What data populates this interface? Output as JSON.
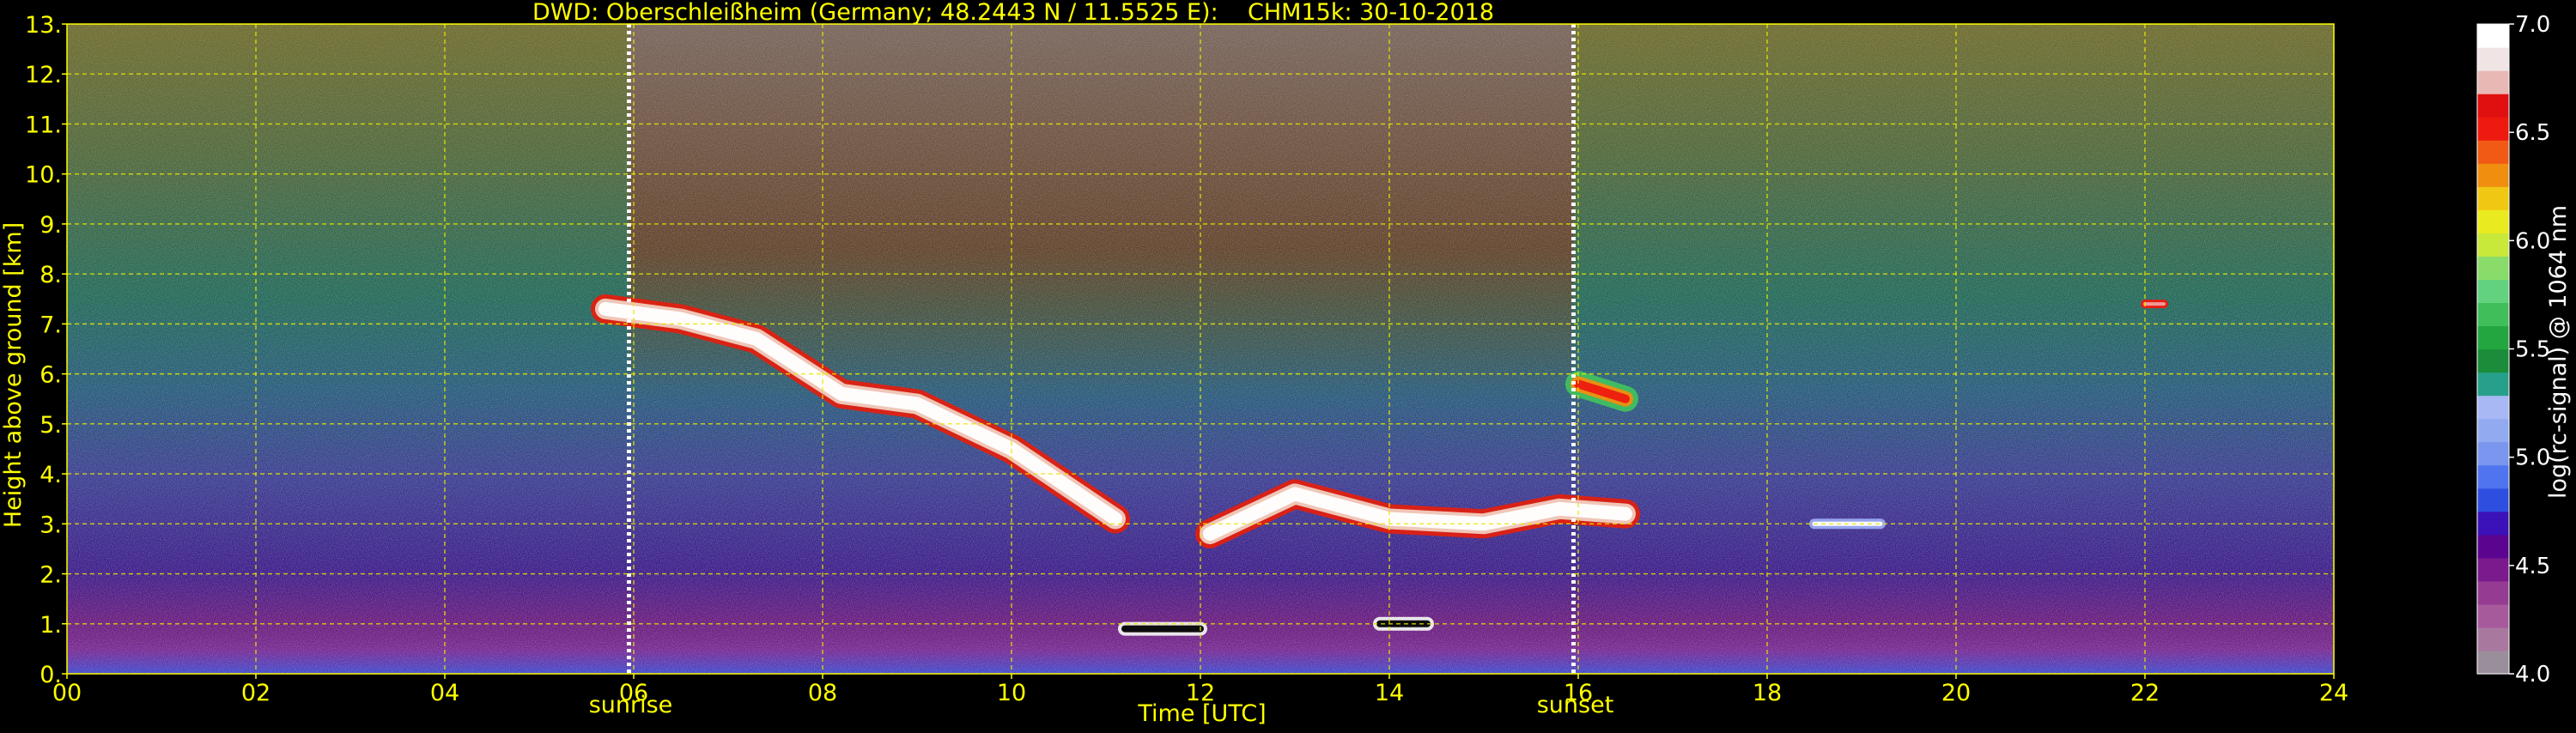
{
  "chart_data": {
    "type": "heatmap",
    "title": "DWD: Oberschleißheim (Germany; 48.2443 N / 11.5525 E):    CHM15k: 30-10-2018",
    "xlabel": "Time [UTC]",
    "ylabel": "Height above ground [km]",
    "colorbar_label": "log(rc-signal) @ 1064 nm",
    "xlim": [
      0,
      24
    ],
    "ylim": [
      0,
      13
    ],
    "x_ticks": [
      0,
      2,
      4,
      6,
      8,
      10,
      12,
      14,
      16,
      18,
      20,
      22,
      24
    ],
    "x_tick_labels": [
      "00",
      "02",
      "04",
      "06",
      "08",
      "10",
      "12",
      "14",
      "16",
      "18",
      "20",
      "22",
      "24"
    ],
    "y_ticks": [
      0,
      1,
      2,
      3,
      4,
      5,
      6,
      7,
      8,
      9,
      10,
      11,
      12,
      13
    ],
    "y_tick_labels": [
      "0.",
      "1.",
      "2.",
      "3.",
      "4.",
      "5.",
      "6.",
      "7.",
      "8.",
      "9.",
      "10.",
      "11.",
      "12.",
      "13."
    ],
    "grid": true,
    "colorbar_range": [
      4.0,
      7.0
    ],
    "colorbar_ticks": [
      4.0,
      4.5,
      5.0,
      5.5,
      6.0,
      6.5,
      7.0
    ],
    "colorbar_tick_labels": [
      "4.0",
      "4.5",
      "5.0",
      "5.5",
      "6.0",
      "6.5",
      "7.0"
    ],
    "colorbar_colors": [
      "#9a8e9a",
      "#a8789e",
      "#a65a9c",
      "#953c92",
      "#7a1a8c",
      "#5a0490",
      "#3a12b8",
      "#2e4ee0",
      "#4f74ee",
      "#7a96ee",
      "#92aaf0",
      "#a8b8f4",
      "#26a08a",
      "#1a8c3a",
      "#23a640",
      "#3fbe5a",
      "#62d27e",
      "#8adc6a",
      "#c8e83a",
      "#eaea20",
      "#f0c814",
      "#f08e10",
      "#f05a14",
      "#ee1a10",
      "#e01010",
      "#e8b8b4",
      "#f0e4e4",
      "#ffffff"
    ],
    "events": [
      {
        "label": "sunrise",
        "x": 5.95
      },
      {
        "label": "sunset",
        "x": 15.95
      }
    ],
    "features": [
      {
        "name": "daylight background noise",
        "x_start": 5.95,
        "x_end": 15.95,
        "height_min_km": 5.5,
        "height_max_km": 13
      },
      {
        "name": "boundary layer aerosol",
        "x_start": 0,
        "x_end": 24,
        "height_min_km": 0,
        "height_max_km": 1.0
      },
      {
        "name": "cloud layer",
        "points": [
          [
            5.7,
            7.3
          ],
          [
            6.5,
            7.1
          ],
          [
            7.3,
            6.7
          ],
          [
            8.2,
            5.6
          ],
          [
            9.0,
            5.4
          ],
          [
            10.0,
            4.5
          ],
          [
            11.1,
            3.1
          ]
        ]
      },
      {
        "name": "cloud layer",
        "points": [
          [
            12.1,
            2.8
          ],
          [
            13.0,
            3.6
          ],
          [
            14.0,
            3.1
          ],
          [
            15.0,
            3.0
          ],
          [
            15.8,
            3.3
          ],
          [
            16.5,
            3.2
          ]
        ]
      },
      {
        "name": "convective cloud",
        "points": [
          [
            16.0,
            5.8
          ],
          [
            16.5,
            5.5
          ]
        ]
      },
      {
        "name": "low cloud",
        "points": [
          [
            11.2,
            0.9
          ],
          [
            12.0,
            0.9
          ]
        ]
      },
      {
        "name": "low cloud",
        "points": [
          [
            13.9,
            1.0
          ],
          [
            14.4,
            1.0
          ]
        ]
      },
      {
        "name": "thin cloud",
        "points": [
          [
            18.5,
            3.0
          ],
          [
            19.2,
            3.0
          ]
        ]
      },
      {
        "name": "cirrus",
        "points": [
          [
            22.0,
            7.4
          ],
          [
            22.2,
            7.4
          ]
        ]
      }
    ]
  }
}
